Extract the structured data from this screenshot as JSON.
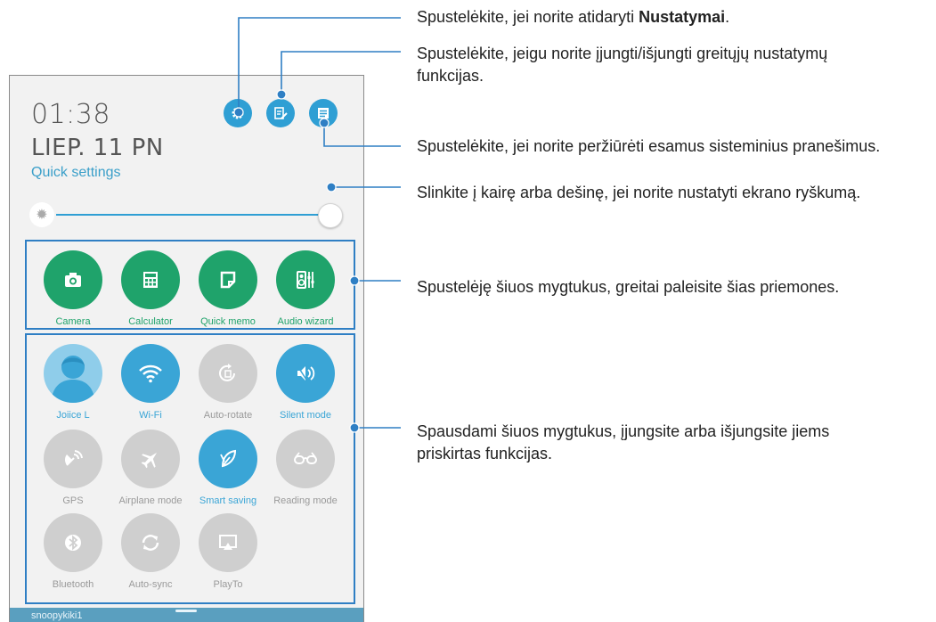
{
  "status": {
    "time": "01:38",
    "date": "LIEP. 11 PN",
    "quick_settings": "Quick settings"
  },
  "header_icons": {
    "settings": "gear-icon",
    "edit": "edit-settings-icon",
    "notifications": "notifications-list-icon"
  },
  "brightness": {
    "level_fraction": 1.0
  },
  "tools": [
    {
      "label": "Camera",
      "icon": "camera-icon"
    },
    {
      "label": "Calculator",
      "icon": "calculator-icon"
    },
    {
      "label": "Quick memo",
      "icon": "memo-icon"
    },
    {
      "label": "Audio wizard",
      "icon": "audio-wizard-icon"
    }
  ],
  "toggles": [
    {
      "label": "Joiice L",
      "state": "on",
      "icon": "avatar"
    },
    {
      "label": "Wi-Fi",
      "state": "on",
      "icon": "wifi-icon"
    },
    {
      "label": "Auto-rotate",
      "state": "off",
      "icon": "rotate-icon"
    },
    {
      "label": "Silent mode",
      "state": "on",
      "icon": "speaker-icon"
    },
    {
      "label": "GPS",
      "state": "off",
      "icon": "gps-icon"
    },
    {
      "label": "Airplane mode",
      "state": "off",
      "icon": "airplane-icon"
    },
    {
      "label": "Smart saving",
      "state": "on",
      "icon": "leaf-icon"
    },
    {
      "label": "Reading mode",
      "state": "off",
      "icon": "glasses-icon"
    },
    {
      "label": "Bluetooth",
      "state": "off",
      "icon": "bluetooth-icon"
    },
    {
      "label": "Auto-sync",
      "state": "off",
      "icon": "sync-icon"
    },
    {
      "label": "PlayTo",
      "state": "off",
      "icon": "playto-icon"
    }
  ],
  "bottom_bar": {
    "user": "snoopykiki1"
  },
  "callouts": {
    "settings_pre": "Spustelėkite, jei norite atidaryti ",
    "settings_bold": "Nustatymai",
    "settings_post": ".",
    "edit": "Spustelėkite, jeigu norite įjungti/išjungti greitųjų nustatymų funkcijas.",
    "notifications": "Spustelėkite, jei norite peržiūrėti esamus sisteminius pranešimus.",
    "brightness": "Slinkite į kairę arba dešinę, jei norite nustatyti ekrano ryškumą.",
    "tools": "Spustelėję šiuos mygtukus, greitai paleisite šias priemones.",
    "toggles": "Spausdami šiuos mygtukus, įjungsite arba išjungsite jiems priskirtas funkcijas."
  },
  "colors": {
    "accent_blue": "#2f9fd4",
    "tool_green": "#1fa36b",
    "off_grey": "#cfcfcf",
    "callout_line": "#2f7fc4"
  }
}
